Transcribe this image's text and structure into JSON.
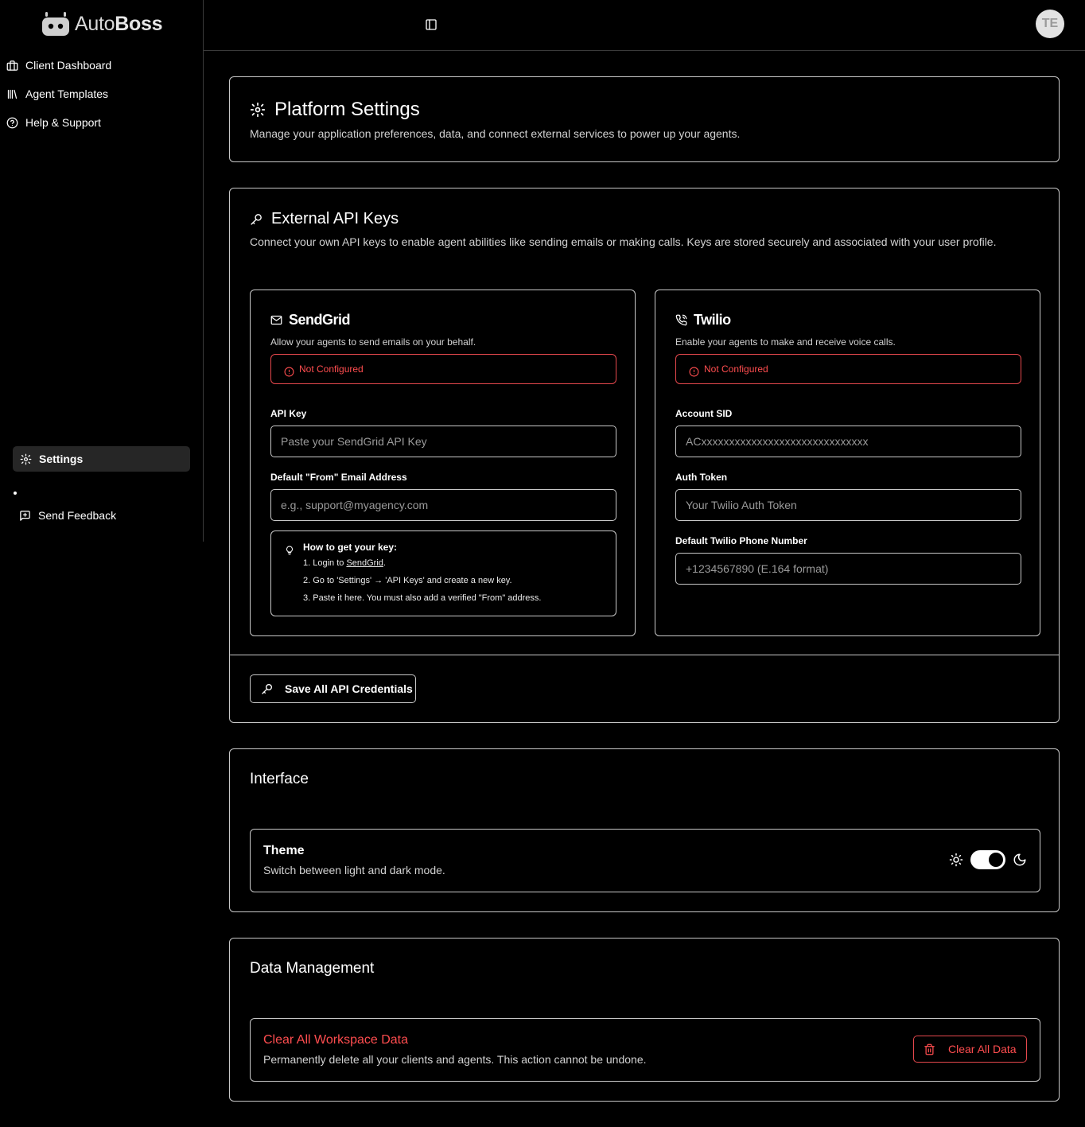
{
  "app": {
    "name_light": "Auto",
    "name_bold": "Boss"
  },
  "colors": {
    "background": "#000000",
    "border": "#c8c8c8",
    "danger": "#ff4d4f",
    "active_nav": "#262626"
  },
  "sidebar": {
    "items": [
      {
        "label": "Client Dashboard",
        "icon": "briefcase-icon"
      },
      {
        "label": "Agent Templates",
        "icon": "library-icon"
      },
      {
        "label": "Help & Support",
        "icon": "help-circle-icon"
      }
    ],
    "settings_label": "Settings",
    "feedback_label": "Send Feedback"
  },
  "header": {
    "avatar_initials": "TE"
  },
  "platform": {
    "title": "Platform Settings",
    "description": "Manage your application preferences, data, and connect external services to power up your agents."
  },
  "api_keys": {
    "title": "External API Keys",
    "description": "Connect your own API keys to enable agent abilities like sending emails or making calls. Keys are stored securely and associated with your user profile.",
    "save_label": "Save All API Credentials",
    "sendgrid": {
      "title": "SendGrid",
      "description": "Allow your agents to send emails on your behalf.",
      "status": "Not Configured",
      "api_key_label": "API Key",
      "api_key_placeholder": "Paste your SendGrid API Key",
      "from_label": "Default \"From\" Email Address",
      "from_placeholder": "e.g., support@myagency.com",
      "tip": {
        "title": "How to get your key:",
        "step1_prefix": "1. Login to ",
        "step1_link": "SendGrid",
        "step1_suffix": ".",
        "step2": "2. Go to 'Settings' → 'API Keys' and create a new key.",
        "step3": "3. Paste it here. You must also add a verified \"From\" address."
      }
    },
    "twilio": {
      "title": "Twilio",
      "description": "Enable your agents to make and receive voice calls.",
      "status": "Not Configured",
      "sid_label": "Account SID",
      "sid_placeholder": "ACxxxxxxxxxxxxxxxxxxxxxxxxxxxxxx",
      "token_label": "Auth Token",
      "token_placeholder": "Your Twilio Auth Token",
      "phone_label": "Default Twilio Phone Number",
      "phone_placeholder": "+1234567890 (E.164 format)"
    }
  },
  "interface": {
    "title": "Interface",
    "theme_title": "Theme",
    "theme_description": "Switch between light and dark mode.",
    "dark_mode_enabled": true
  },
  "data_management": {
    "title": "Data Management",
    "clear_title": "Clear All Workspace Data",
    "clear_description": "Permanently delete all your clients and agents. This action cannot be undone.",
    "clear_button": "Clear All Data"
  }
}
